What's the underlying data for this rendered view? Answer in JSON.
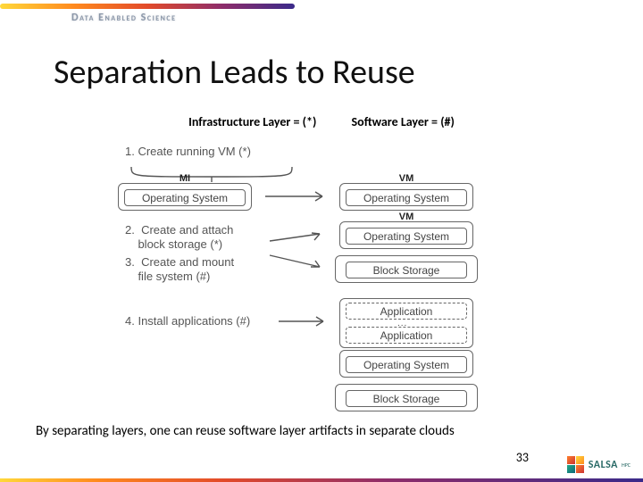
{
  "brand": "Data Enabled Science",
  "title": "Separation Leads to Reuse",
  "legend": {
    "infra": "Infrastructure Layer = (*)",
    "soft": "Software Layer = (#)"
  },
  "steps": {
    "s1": "1.  Create running VM (*)",
    "s2": "2.  Create and attach\n    block storage (*)",
    "s3": "3.  Create and mount\n    file system (#)",
    "s4": "4.  Install applications (#)"
  },
  "labels": {
    "mi": "MI",
    "vm": "VM"
  },
  "boxes": {
    "os": "Operating System",
    "bs": "Block Storage",
    "app": "Application",
    "ellipsis": "..."
  },
  "caption": "By separating layers, one can reuse software layer artifacts in separate clouds",
  "page": "33",
  "logo": {
    "text": "SALSA",
    "sub": "HPC"
  }
}
